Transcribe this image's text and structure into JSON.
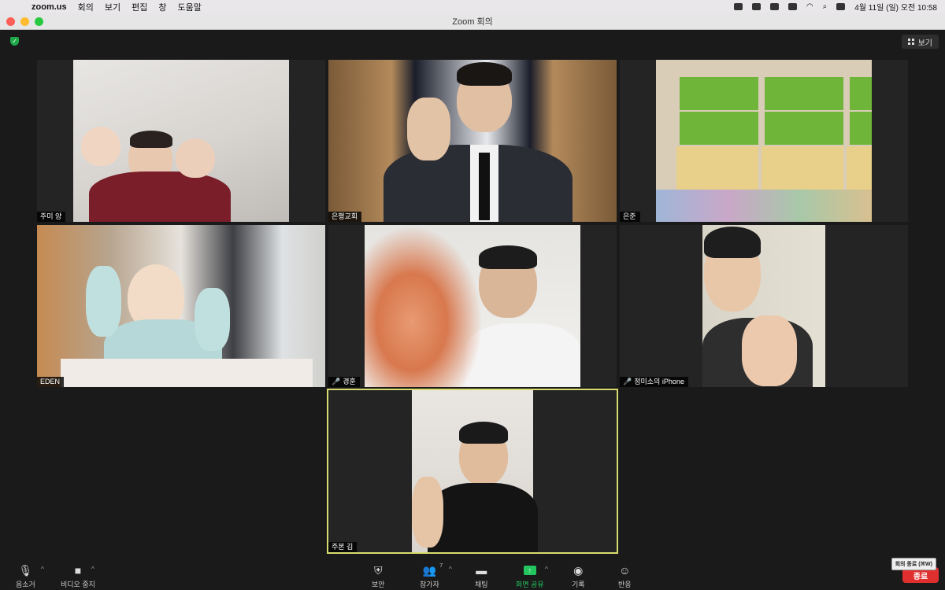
{
  "menubar": {
    "app": "zoom.us",
    "items": [
      "회의",
      "보기",
      "편집",
      "창",
      "도움말"
    ],
    "datetime": "4월 11일 (일) 오전 10:58"
  },
  "window": {
    "title": "Zoom 회의"
  },
  "view_button": {
    "label": "보기"
  },
  "participants": [
    {
      "name": "주미 양",
      "muted": false
    },
    {
      "name": "은평교회",
      "muted": false
    },
    {
      "name": "은준",
      "muted": false
    },
    {
      "name": "EDEN",
      "muted": false
    },
    {
      "name": "경훈",
      "muted": true
    },
    {
      "name": "정미소의 iPhone",
      "muted": true
    },
    {
      "name": "주본 김",
      "muted": false,
      "active_speaker": true
    }
  ],
  "toolbar": {
    "audio": "음소거",
    "video": "비디오 중지",
    "security": "보안",
    "participants": "참가자",
    "participants_count": "7",
    "chat": "채팅",
    "share": "화면 공유",
    "record": "기록",
    "reactions": "반응",
    "end": "종료",
    "end_tooltip": "회의 종료 (⌘W)"
  },
  "colors": {
    "share_green": "#22c55e",
    "end_red": "#e02f2f",
    "active_border": "#d8dc6e"
  }
}
